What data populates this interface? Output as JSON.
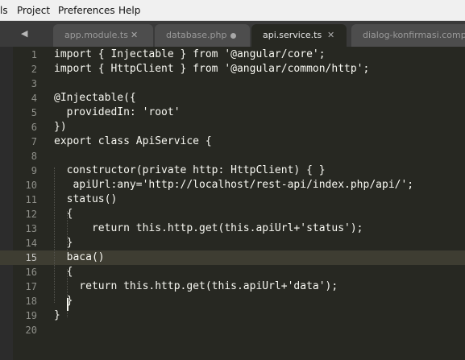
{
  "menu": [
    "ls",
    "Project",
    "Preferences",
    "Help"
  ],
  "nav_arrows": "◀ ▶",
  "tabs": [
    {
      "label": "app.module.ts",
      "modified": false,
      "active": false
    },
    {
      "label": "database.php",
      "modified": true,
      "active": false
    },
    {
      "label": "api.service.ts",
      "modified": false,
      "active": true
    },
    {
      "label": "dialog-konfirmasi.component.ts",
      "modified": false,
      "active": false
    }
  ],
  "close_glyph": "✕",
  "current_line": 15,
  "lines": [
    {
      "n": "1",
      "text": "import { Injectable } from '@angular/core';"
    },
    {
      "n": "2",
      "text": "import { HttpClient } from '@angular/common/http';"
    },
    {
      "n": "3",
      "text": ""
    },
    {
      "n": "4",
      "text": "@Injectable({"
    },
    {
      "n": "5",
      "text": "  providedIn: 'root'"
    },
    {
      "n": "6",
      "text": "})"
    },
    {
      "n": "7",
      "text": "export class ApiService {"
    },
    {
      "n": "8",
      "text": ""
    },
    {
      "n": "9",
      "text": "  constructor(private http: HttpClient) { }"
    },
    {
      "n": "10",
      "text": "   apiUrl:any='http://localhost/rest-api/index.php/api/';"
    },
    {
      "n": "11",
      "text": "  status()"
    },
    {
      "n": "12",
      "text": "  {"
    },
    {
      "n": "13",
      "text": "      return this.http.get(this.apiUrl+'status');"
    },
    {
      "n": "14",
      "text": "  }"
    },
    {
      "n": "15",
      "text": "  baca()"
    },
    {
      "n": "16",
      "text": "  {"
    },
    {
      "n": "17",
      "text": "    return this.http.get(this.apiUrl+'data');"
    },
    {
      "n": "18",
      "text": "  }"
    },
    {
      "n": "19",
      "text": "}"
    },
    {
      "n": "20",
      "text": ""
    }
  ]
}
